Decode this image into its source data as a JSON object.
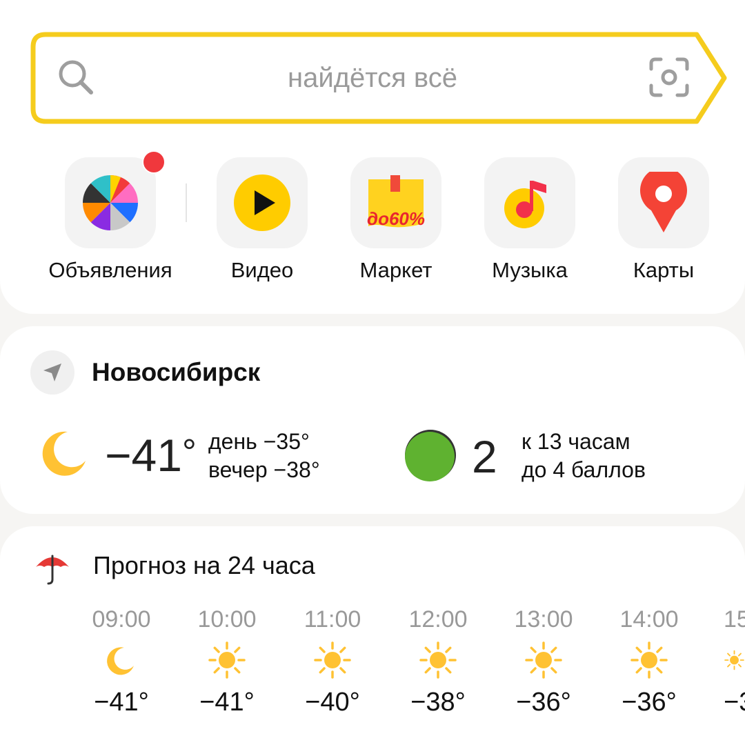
{
  "search": {
    "placeholder": "найдётся всё"
  },
  "services": [
    {
      "label": "Объявления",
      "icon": "color-wheel-icon",
      "has_notification": true
    },
    {
      "label": "Видео",
      "icon": "play-icon"
    },
    {
      "label": "Маркет",
      "icon": "market-box-icon",
      "badge": "до60%"
    },
    {
      "label": "Музыка",
      "icon": "music-note-icon"
    },
    {
      "label": "Карты",
      "icon": "map-pin-icon"
    }
  ],
  "weather": {
    "city": "Новосибирск",
    "current_temp": "−41",
    "degree_symbol": "°",
    "day": "день −35°",
    "evening": "вечер −38°",
    "condition_icon": "moon-icon",
    "traffic": {
      "score": "2",
      "line1": "к 13 часам",
      "line2": "до 4 баллов",
      "color": "#5fb230"
    }
  },
  "forecast": {
    "title": "Прогноз на 24 часа",
    "hours": [
      {
        "time": "09:00",
        "icon": "moon-icon",
        "temp": "−41°"
      },
      {
        "time": "10:00",
        "icon": "sun-icon",
        "temp": "−41°"
      },
      {
        "time": "11:00",
        "icon": "sun-icon",
        "temp": "−40°"
      },
      {
        "time": "12:00",
        "icon": "sun-icon",
        "temp": "−38°"
      },
      {
        "time": "13:00",
        "icon": "sun-icon",
        "temp": "−36°"
      },
      {
        "time": "14:00",
        "icon": "sun-icon",
        "temp": "−36°"
      },
      {
        "time": "15",
        "icon": "sun-icon",
        "temp": "−3"
      }
    ]
  },
  "colors": {
    "search_border": "#f5cc1d",
    "accent_yellow": "#fbc73a",
    "notification": "#f0383d",
    "maps_red": "#f44336"
  }
}
